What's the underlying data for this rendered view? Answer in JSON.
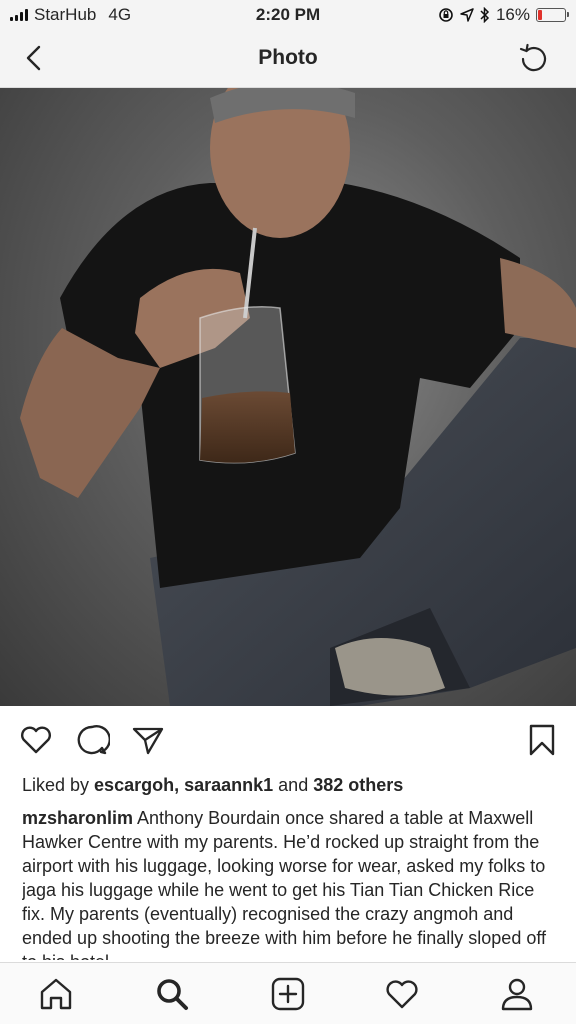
{
  "status_bar": {
    "carrier": "StarHub",
    "network": "4G",
    "time": "2:20 PM",
    "battery_percent": "16%",
    "battery_level": 0.16,
    "battery_color": "#e0312b"
  },
  "nav": {
    "title": "Photo",
    "back_icon": "chevron-left-icon",
    "refresh_icon": "refresh-icon"
  },
  "photo": {
    "alt": "Anthony Bourdain holding a plastic drink bag with a straw"
  },
  "actions": {
    "icons": [
      "heart-icon",
      "comment-icon",
      "share-icon",
      "bookmark-icon"
    ]
  },
  "likes": {
    "prefix": "Liked by ",
    "user1": "escargoh",
    "separator": ", ",
    "user2": "saraannk1",
    "and": " and ",
    "others": "382 others"
  },
  "caption": {
    "username": "mzsharonlim",
    "text": " Anthony Bourdain once shared a table at Maxwell Hawker Centre with my parents. He’d rocked up straight from the airport with his luggage, looking worse for wear, asked my folks to jaga his luggage while he went to get his Tian Tian Chicken Rice fix. My parents (eventually) recognised the crazy angmoh and ended up shooting the breeze with him before he finally sloped off to his hotel."
  },
  "tabbar": {
    "icons": [
      "home-icon",
      "search-icon",
      "add-post-icon",
      "activity-heart-icon",
      "profile-icon"
    ]
  }
}
